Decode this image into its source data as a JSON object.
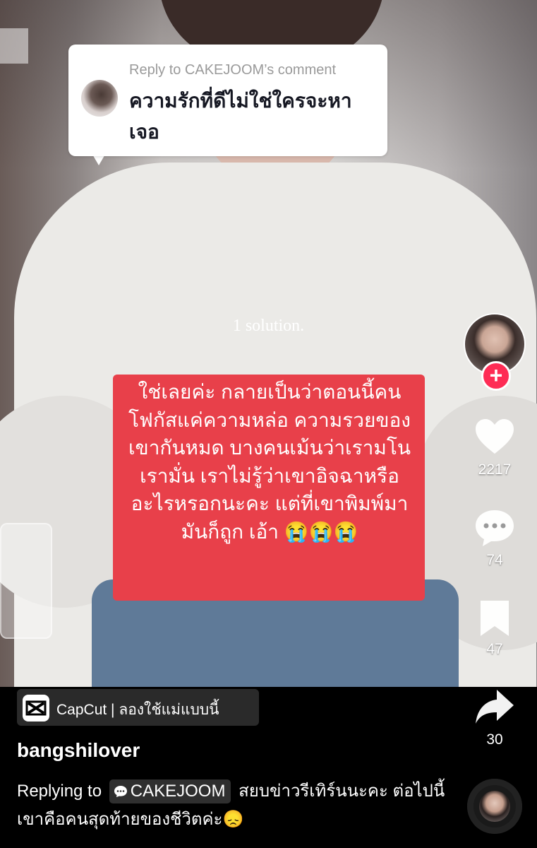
{
  "reply_bubble": {
    "header": "Reply to CAKEJOOM’s comment",
    "text": "ความรักที่ดีไม่ใช่ใครจะหาเจอ"
  },
  "video_overlay": {
    "solution_text": "1 solution.",
    "red_box_text": "ใช่เลยค่ะ กลายเป็นว่าตอนนี้คนโฟกัสแค่ความหล่อ ความรวยของเขากันหมด บางคนเม้นว่าเรามโน เรามั่น เราไม่รู้ว่าเขาอิจฉาหรืออะไรหรอกนะคะ แต่ที่เขาพิมพ์มามันก็ถูก เอ้า 😭😭😭"
  },
  "rail": {
    "likes": "2217",
    "comments": "74",
    "saves": "47",
    "shares": "30"
  },
  "capcut": {
    "label": "CapCut | ลองใช้แม่แบบนี้"
  },
  "post": {
    "username": "bangshilover",
    "replying_to": "Replying to",
    "tag": "CAKEJOOM",
    "caption": "สยบข่าวรีเทิร์นนะคะ ต่อไปนี้เขาคือคนสุดท้ายของชีวิตค่ะ😞"
  },
  "colors": {
    "red_box": "#e8404a",
    "follow_plus": "#fe2c55",
    "background": "#000000"
  },
  "icons": [
    "heart-icon",
    "comment-icon",
    "bookmark-icon",
    "share-icon",
    "plus-icon",
    "capcut-icon",
    "comment-bubble-icon",
    "music-disc-icon"
  ]
}
